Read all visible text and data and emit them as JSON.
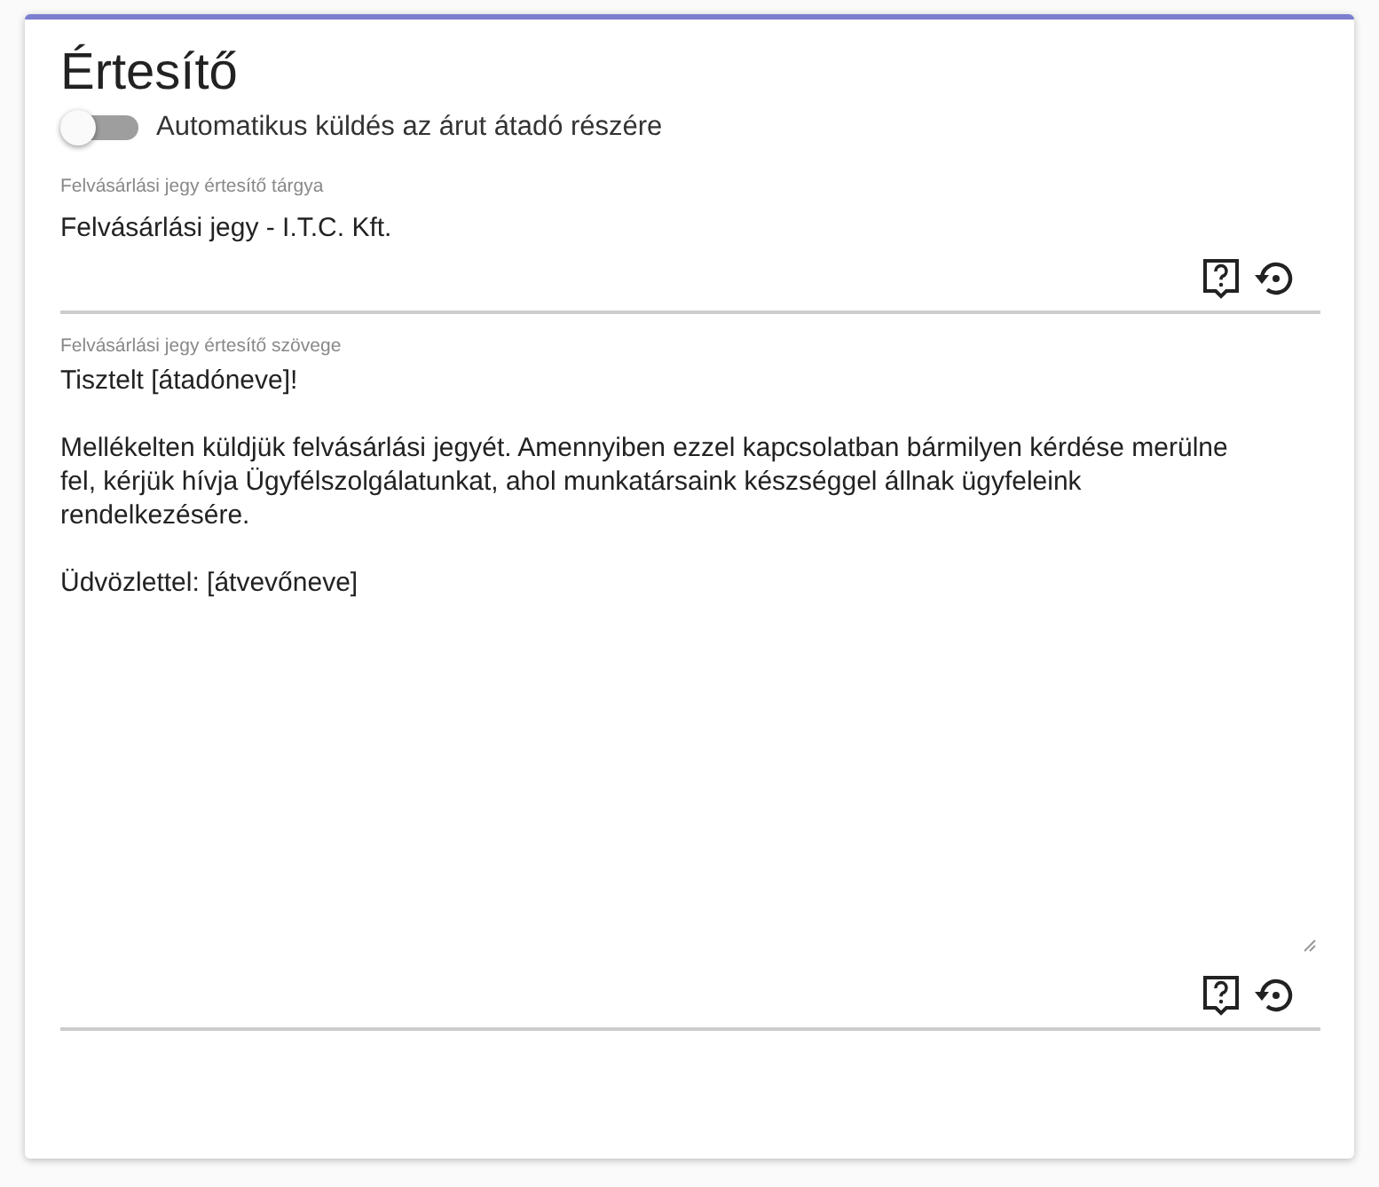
{
  "title": "Értesítő",
  "toggle": {
    "label": "Automatikus küldés az árut átadó részére",
    "on": false
  },
  "fields": [
    {
      "label": "Felvásárlási jegy értesítő tárgya",
      "value": "Felvásárlási jegy - I.T.C. Kft.",
      "kind": "input"
    },
    {
      "label": "Felvásárlási jegy értesítő szövege",
      "value": "Tisztelt [átadóneve]!\n\nMellékelten küldjük felvásárlási jegyét. Amennyiben ezzel kapcsolatban bármilyen kérdése merülne fel, kérjük hívja Ügyfélszolgálatunkat, ahol munkatársaink készséggel állnak ügyfeleink rendelkezésére.\n\nÜdvözlettel: [átvevőneve]",
      "kind": "textarea"
    }
  ]
}
